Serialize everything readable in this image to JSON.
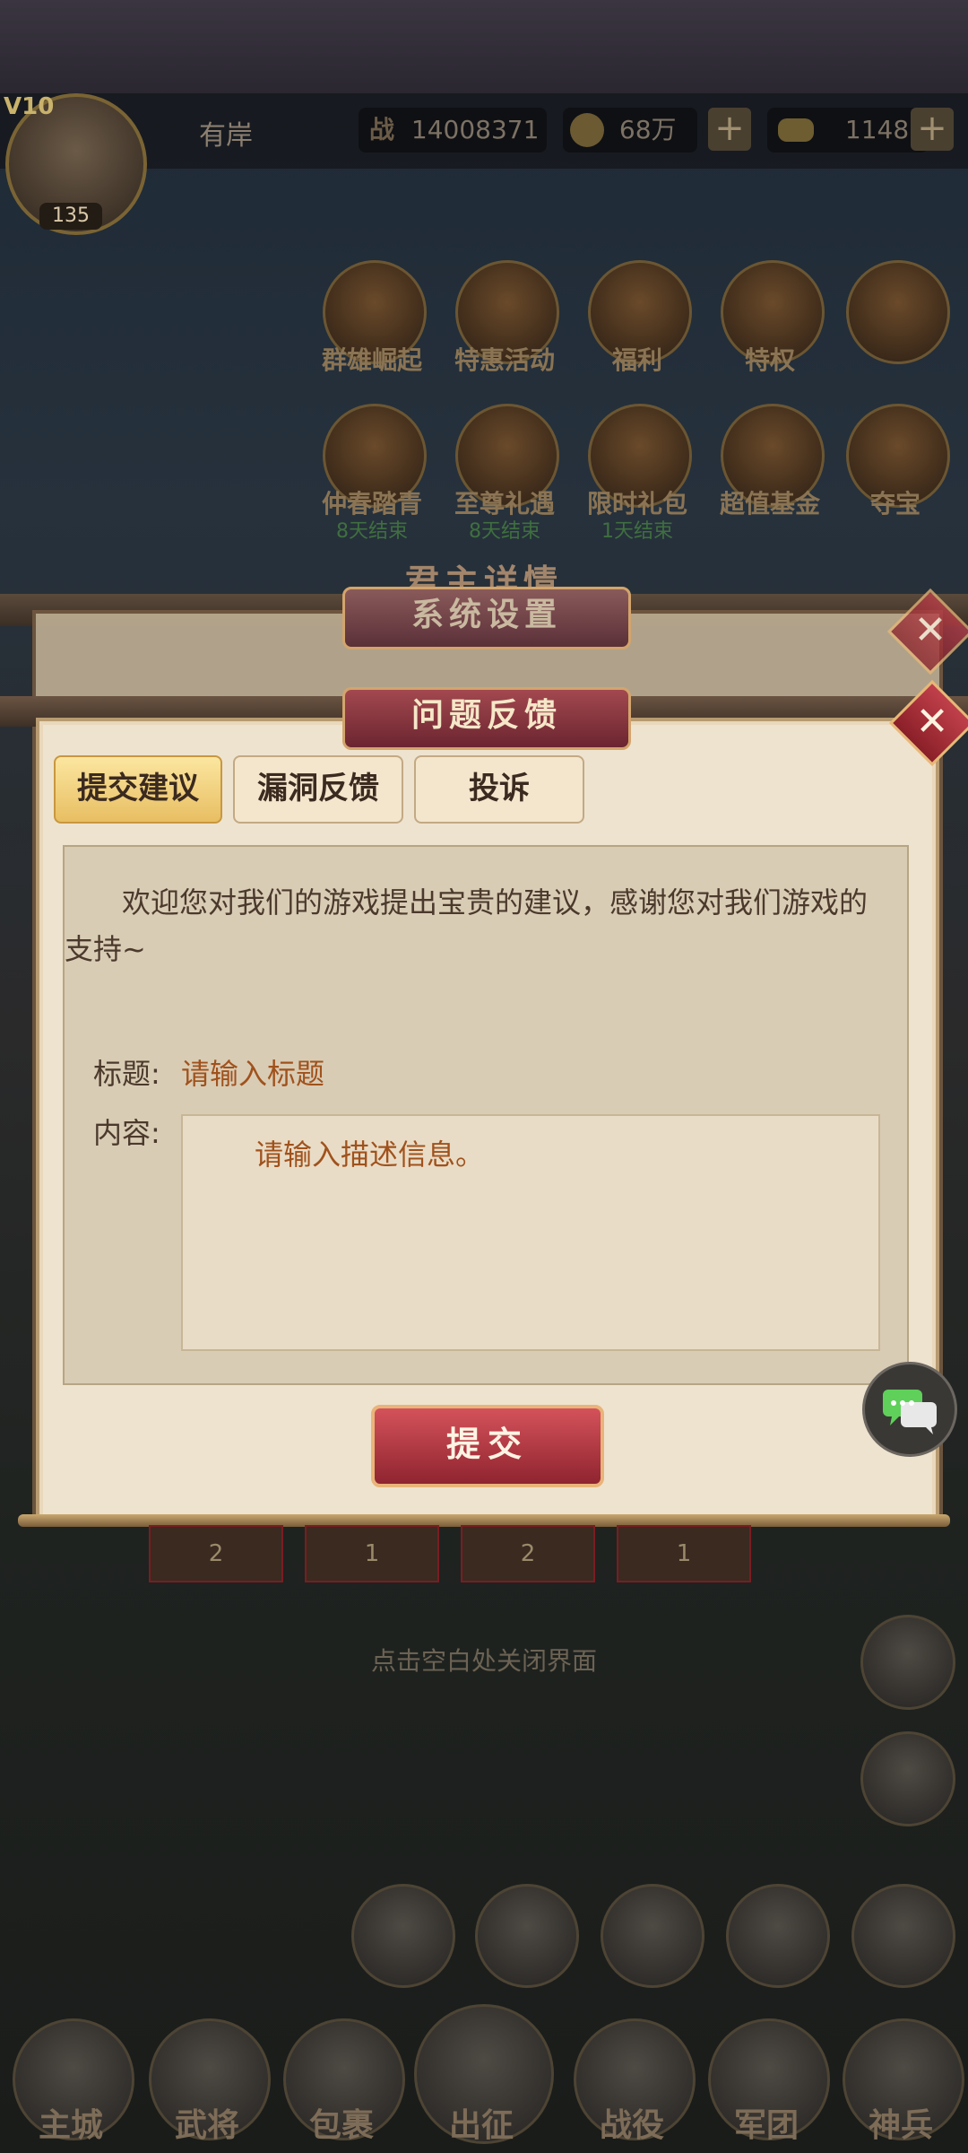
{
  "hud": {
    "vip": "V10",
    "level": "135",
    "player_name": "有岸",
    "power_icon": "战",
    "power_value": "14008371",
    "coins": "68万",
    "ingots": "1148"
  },
  "activity_icons": [
    {
      "label": "群雄崛起",
      "sub": ""
    },
    {
      "label": "特惠活动",
      "sub": ""
    },
    {
      "label": "福利",
      "sub": ""
    },
    {
      "label": "特权",
      "sub": ""
    },
    {
      "label": "",
      "sub": ""
    },
    {
      "label": "仲春踏青",
      "sub": "8天结束"
    },
    {
      "label": "至尊礼遇",
      "sub": "8天结束"
    },
    {
      "label": "限时礼包",
      "sub": "1天结束"
    },
    {
      "label": "超值基金",
      "sub": ""
    },
    {
      "label": "夺宝",
      "sub": ""
    }
  ],
  "background_title": "君主详情",
  "system_panel": {
    "title": "系统设置"
  },
  "feedback_panel": {
    "title": "问题反馈",
    "tabs": [
      {
        "label": "提交建议",
        "active": true
      },
      {
        "label": "漏洞反馈",
        "active": false
      },
      {
        "label": "投诉",
        "active": false
      }
    ],
    "intro_line1": "欢迎您对我们的游戏提出宝贵的建议，感谢您对我们游戏的",
    "intro_line2": "支持~",
    "title_label": "标题:",
    "title_placeholder": "请输入标题",
    "content_label": "内容:",
    "content_placeholder": "请输入描述信息。",
    "submit_label": "提交"
  },
  "card_counts": [
    "2",
    "1",
    "2",
    "1"
  ],
  "close_hint": "点击空白处关闭界面",
  "bottom_nav": [
    {
      "label": "主城"
    },
    {
      "label": "武将"
    },
    {
      "label": "包裹"
    },
    {
      "label": "出征"
    },
    {
      "label": "战役"
    },
    {
      "label": "军团"
    },
    {
      "label": "神兵"
    }
  ],
  "colors": {
    "panel_bg": "#eee3cf",
    "accent_red": "#8f2430",
    "placeholder": "#a0521c",
    "tab_active": "#e8be62"
  }
}
